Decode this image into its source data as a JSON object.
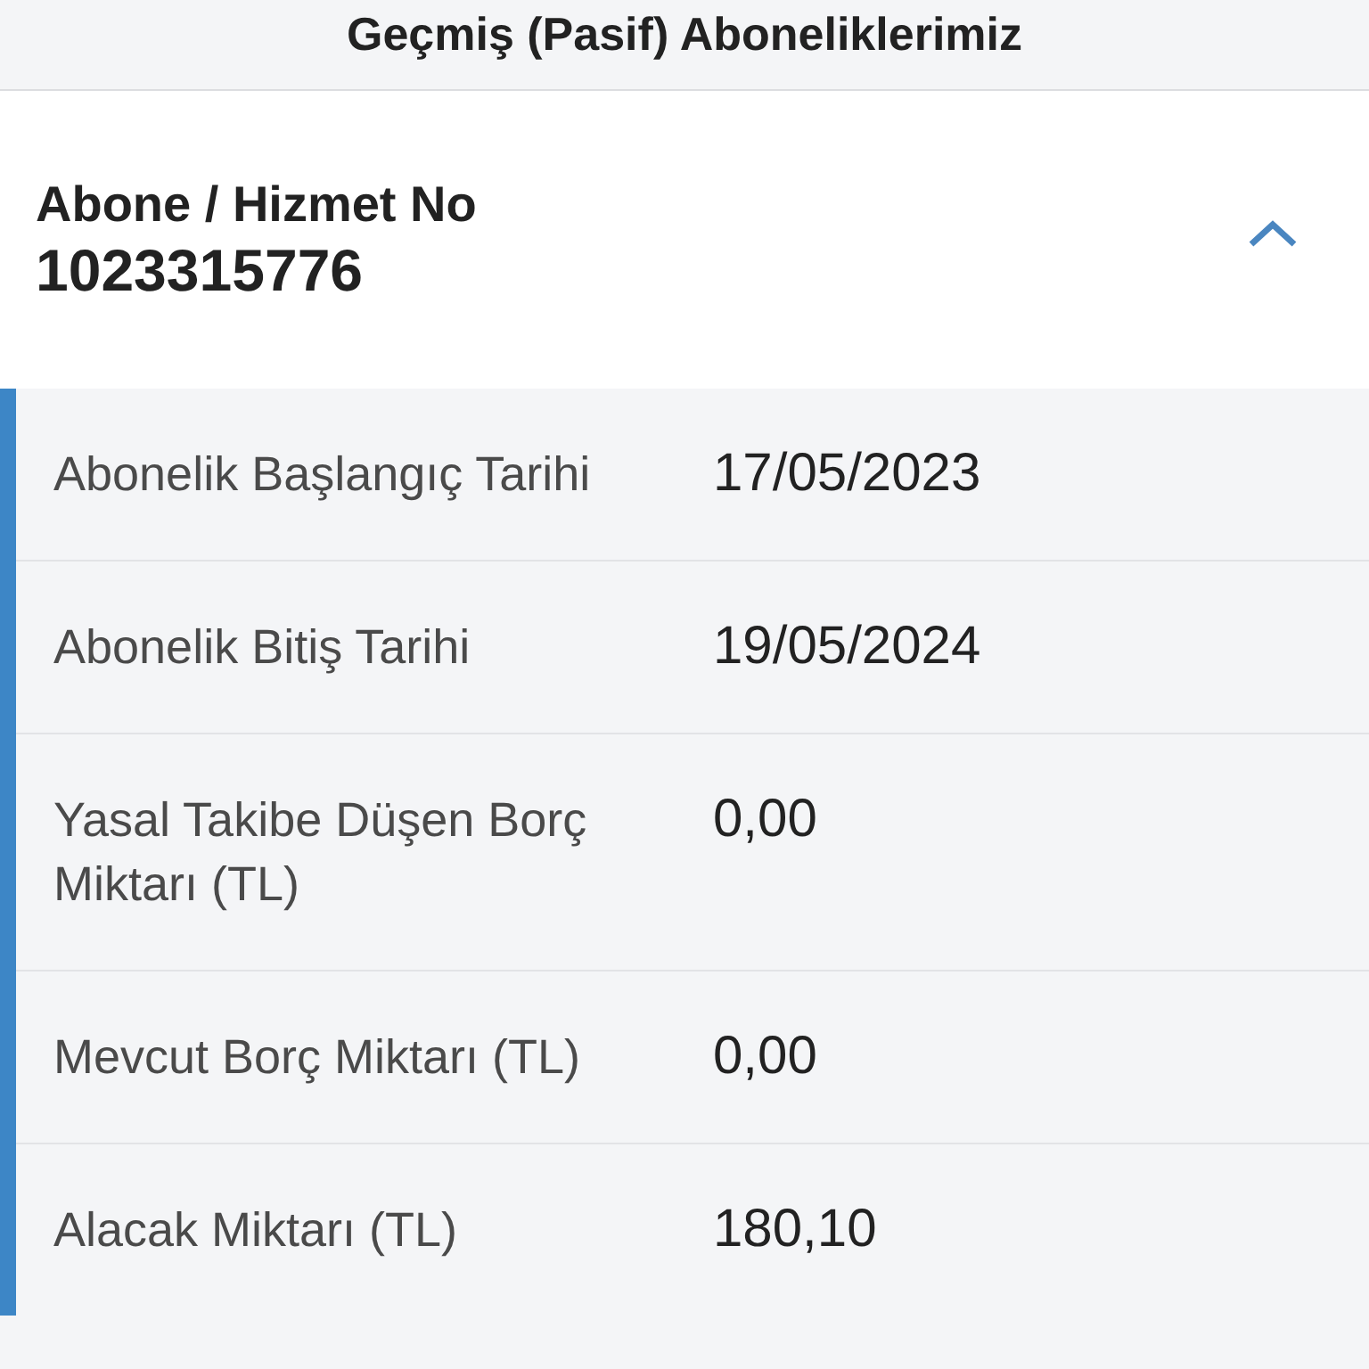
{
  "page_title": "Geçmiş (Pasif) Aboneliklerimiz",
  "subscription": {
    "label": "Abone / Hizmet No",
    "number": "1023315776",
    "expanded": true,
    "details": [
      {
        "label": "Abonelik Başlangıç Tarihi",
        "value": "17/05/2023"
      },
      {
        "label": "Abonelik Bitiş Tarihi",
        "value": "19/05/2024"
      },
      {
        "label": "Yasal Takibe Düşen Borç Miktarı (TL)",
        "value": "0,00"
      },
      {
        "label": "Mevcut Borç Miktarı (TL)",
        "value": "0,00"
      },
      {
        "label": "Alacak Miktarı (TL)",
        "value": "180,10"
      }
    ]
  }
}
